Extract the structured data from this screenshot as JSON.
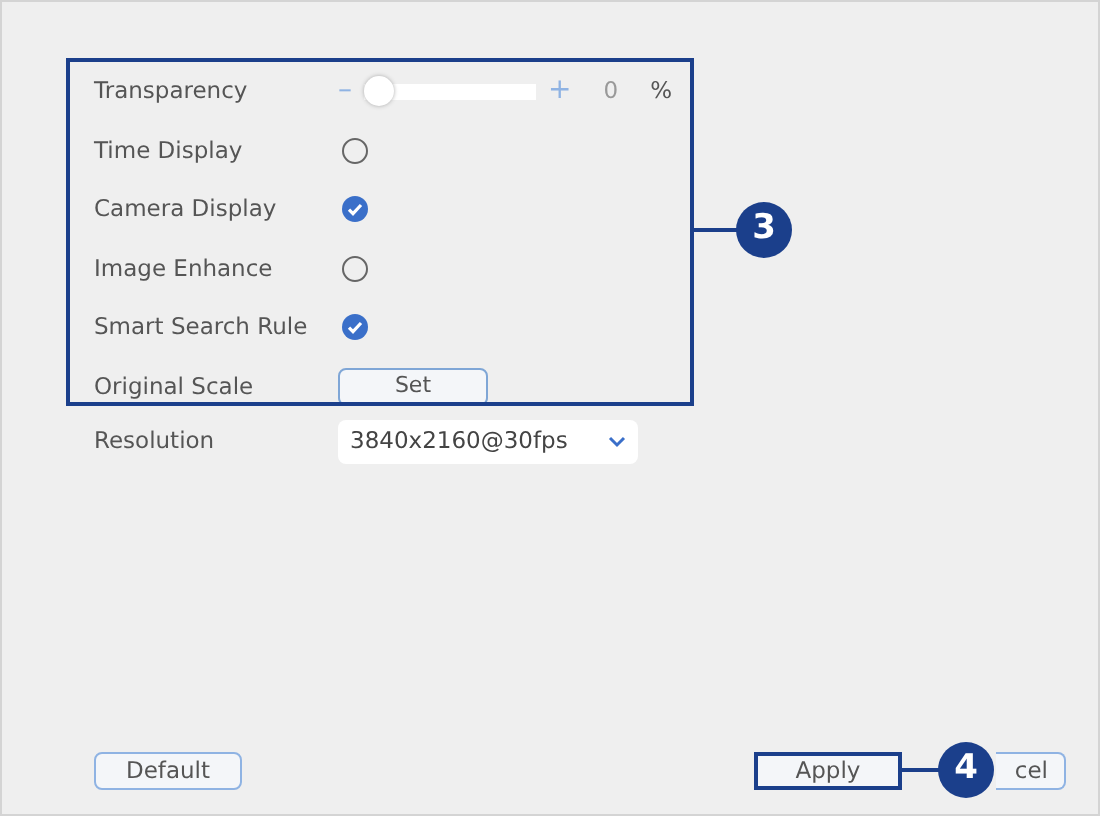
{
  "settings": [
    {
      "kind": "slider",
      "label": "Transparency",
      "minus": "–",
      "plus": "+",
      "level": 0,
      "reading": "0",
      "unit": "%"
    },
    {
      "kind": "check",
      "label": "Time Display",
      "checked": false
    },
    {
      "kind": "check",
      "label": "Camera Display",
      "checked": true
    },
    {
      "kind": "check",
      "label": "Image Enhance",
      "checked": false
    },
    {
      "kind": "check",
      "label": "Smart Search Rule",
      "checked": true
    },
    {
      "kind": "button",
      "label": "Original Scale",
      "button": "Set"
    }
  ],
  "settings_callout": "3",
  "resolution": {
    "label": "Resolution",
    "value": "3840x2160@30fps"
  },
  "buttons": [
    {
      "label": "Default",
      "highlighted": false
    },
    {
      "label": "Apply",
      "highlighted": true
    },
    {
      "label": "cel",
      "highlighted": false
    }
  ],
  "buttons_callout": "4"
}
